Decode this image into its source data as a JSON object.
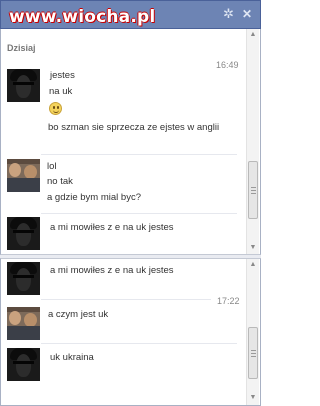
{
  "window": {
    "watermark": "www.wiocha.pl",
    "gear_icon": "gear-icon",
    "close_icon": "close-icon"
  },
  "top_pane": {
    "date_label": "Dzisiaj",
    "time": "16:49",
    "groups": [
      {
        "avatar": "masked-person-avatar",
        "lines": [
          "jestes",
          "na uk"
        ],
        "emoticon": "smiley-icon",
        "tail": "bo szman sie sprzecza ze ejstes  w anglii"
      },
      {
        "avatar": "photo-avatar",
        "lines": [
          "lol",
          "no tak",
          "a gdzie bym mial byc?"
        ]
      },
      {
        "avatar": "masked-person-avatar",
        "lines": [
          "a mi mowiłes z e na uk jestes"
        ]
      }
    ]
  },
  "bottom_pane": {
    "time": "17:22",
    "groups": [
      {
        "avatar": "masked-person-avatar",
        "lines": [
          "a mi mowiłes z e na uk jestes"
        ]
      },
      {
        "avatar": "photo-avatar",
        "lines": [
          "a czym jest uk"
        ]
      },
      {
        "avatar": "masked-person-avatar",
        "lines": [
          "uk ukraina"
        ]
      }
    ]
  },
  "colors": {
    "titlebar": "#6d84b4",
    "watermark_outline": "#c00000"
  }
}
